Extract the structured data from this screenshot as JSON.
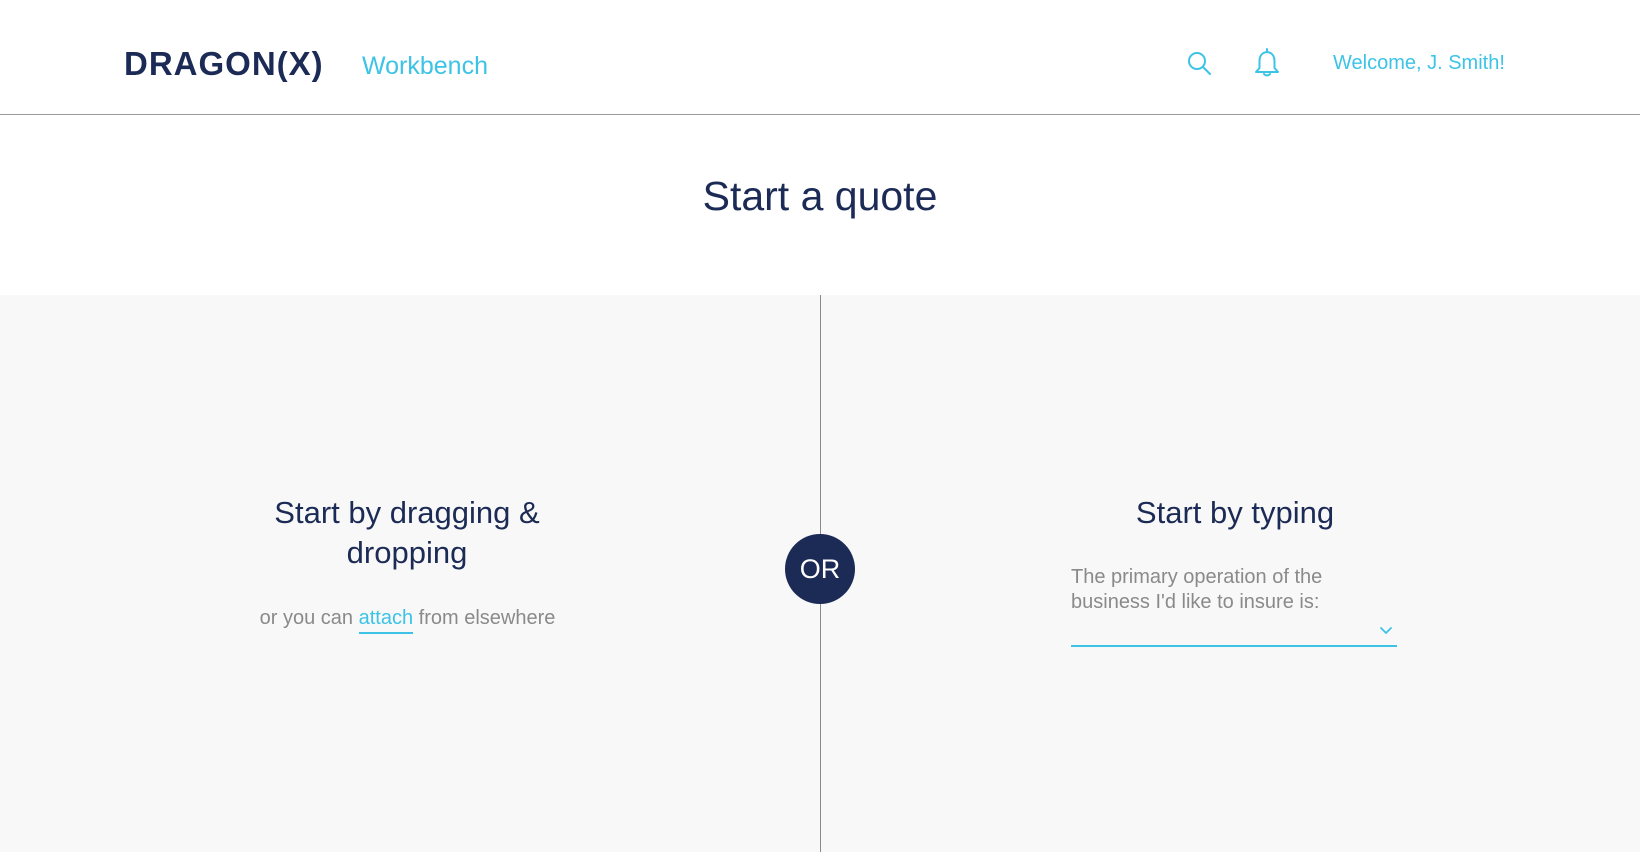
{
  "header": {
    "logo": "DRAGON(X)",
    "app_name": "Workbench",
    "welcome": "Welcome, J. Smith!",
    "icons": [
      "search-icon",
      "bell-icon"
    ]
  },
  "page": {
    "title": "Start a quote"
  },
  "left_panel": {
    "title": "Start by dragging & dropping",
    "prefix": "or you can",
    "link": "attach",
    "suffix": "from elsewhere"
  },
  "separator": {
    "label": "OR"
  },
  "right_panel": {
    "title": "Start by typing",
    "field_label": "The primary operation of the business I'd like to insure is:",
    "field_value": ""
  },
  "colors": {
    "navy": "#1c2b56",
    "accent": "#3cc3e6",
    "muted_text": "#8a8a8a",
    "panel_bg": "#f8f8f8"
  }
}
